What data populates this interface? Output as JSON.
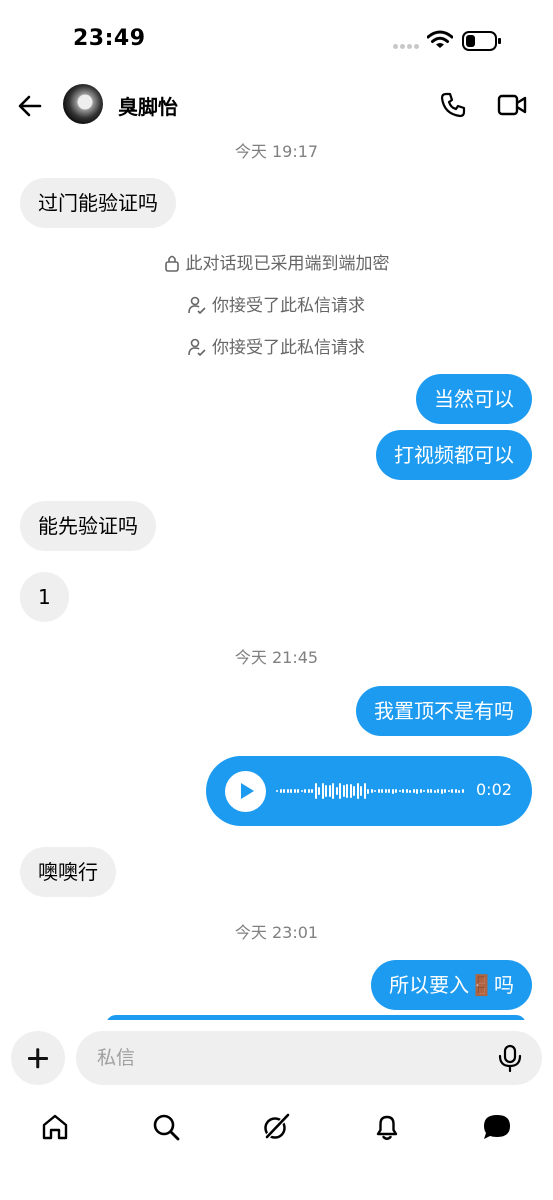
{
  "status": {
    "time": "23:49"
  },
  "header": {
    "contact_name": "臭脚怡"
  },
  "messages": {
    "ts1": "今天 19:17",
    "m1": "过门能验证吗",
    "sys1": "此对话现已采用端到端加密",
    "sys2": "你接受了此私信请求",
    "sys3": "你接受了此私信请求",
    "m2": "当然可以",
    "m3": "打视频都可以",
    "m4": "能先验证吗",
    "m5": "1",
    "ts2": "今天 21:45",
    "m6": "我置顶不是有吗",
    "voice_duration": "0:02",
    "m7": "噢噢行",
    "ts3": "今天 23:01",
    "m8": "所以要入🚪吗"
  },
  "composer": {
    "placeholder": "私信"
  },
  "colors": {
    "accent": "#1d9bf0",
    "incoming_bubble": "#efefef"
  },
  "nav": {
    "items": [
      "home-icon",
      "search-icon",
      "grok-icon",
      "notifications-icon",
      "messages-icon"
    ]
  }
}
